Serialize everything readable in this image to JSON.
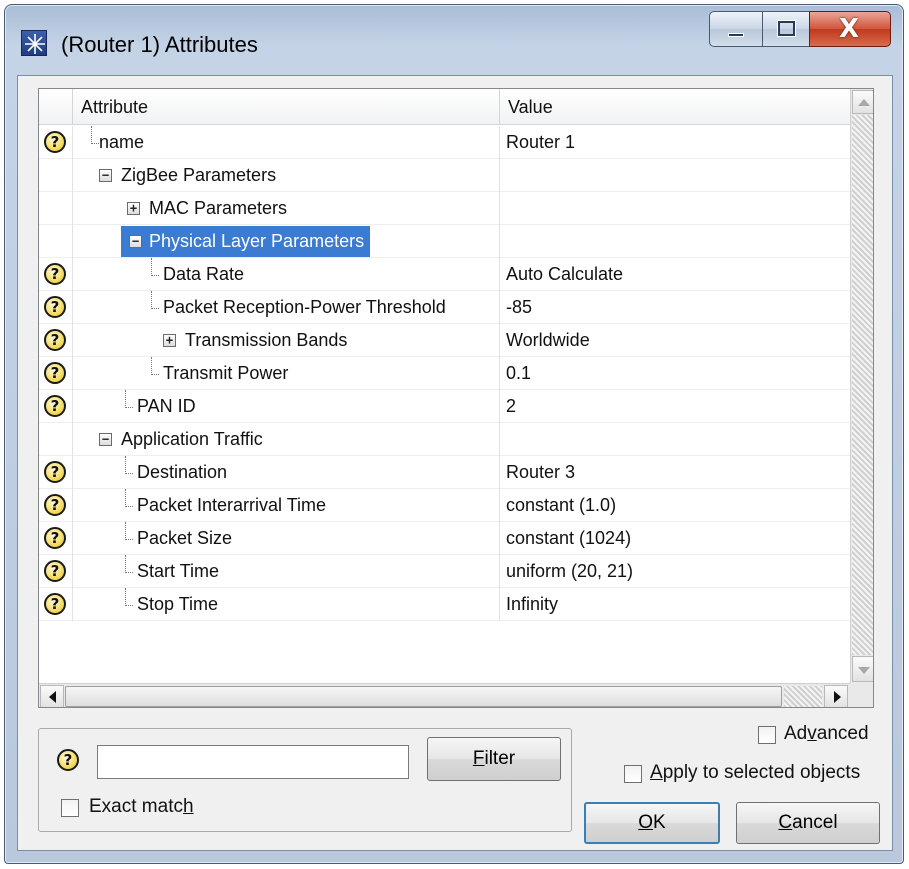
{
  "window": {
    "title": "(Router 1) Attributes",
    "buttons": {
      "minimize": "minimize",
      "maximize": "maximize",
      "close": "close"
    }
  },
  "grid": {
    "columns": [
      "Attribute",
      "Value"
    ],
    "rows": [
      {
        "label": "name",
        "value": "Router 1",
        "help": true
      },
      {
        "label": "ZigBee Parameters",
        "value": "",
        "help": false,
        "expander": "−"
      },
      {
        "label": "MAC Parameters",
        "value": "",
        "help": false,
        "expander": "+"
      },
      {
        "label": "Physical Layer Parameters",
        "value": "",
        "help": false,
        "expander": "−",
        "selected": true
      },
      {
        "label": "Data Rate",
        "value": "Auto Calculate",
        "help": true
      },
      {
        "label": "Packet Reception-Power Threshold",
        "value": "-85",
        "help": true
      },
      {
        "label": "Transmission Bands",
        "value": "Worldwide",
        "help": true,
        "expander": "+"
      },
      {
        "label": "Transmit Power",
        "value": "0.1",
        "help": true
      },
      {
        "label": "PAN ID",
        "value": "2",
        "help": true
      },
      {
        "label": "Application Traffic",
        "value": "",
        "help": false,
        "expander": "−"
      },
      {
        "label": "Destination",
        "value": "Router 3",
        "help": true
      },
      {
        "label": "Packet Interarrival Time",
        "value": "constant (1.0)",
        "help": true
      },
      {
        "label": "Packet Size",
        "value": "constant (1024)",
        "help": true
      },
      {
        "label": "Start Time",
        "value": "uniform (20, 21)",
        "help": true
      },
      {
        "label": "Stop Time",
        "value": "Infinity",
        "help": true
      }
    ]
  },
  "filter": {
    "input_value": "",
    "filter_button": {
      "first": "F",
      "rest": "ilter"
    },
    "exact_match": {
      "before": "Exact matc",
      "key": "h",
      "after": ""
    }
  },
  "options": {
    "advanced": {
      "before": "Ad",
      "key": "v",
      "after": "anced"
    },
    "apply_selected": {
      "before": "",
      "key": "A",
      "after": "pply to selected objects"
    }
  },
  "buttons": {
    "ok": {
      "key": "O",
      "rest": "K"
    },
    "cancel": {
      "key": "C",
      "rest": "ancel"
    }
  },
  "icons": {
    "help": "?",
    "app": "star-icon"
  },
  "colors": {
    "selection": "#3b7bd1",
    "title_bar": "#c4d3e6",
    "close_button": "#c03a1c"
  }
}
